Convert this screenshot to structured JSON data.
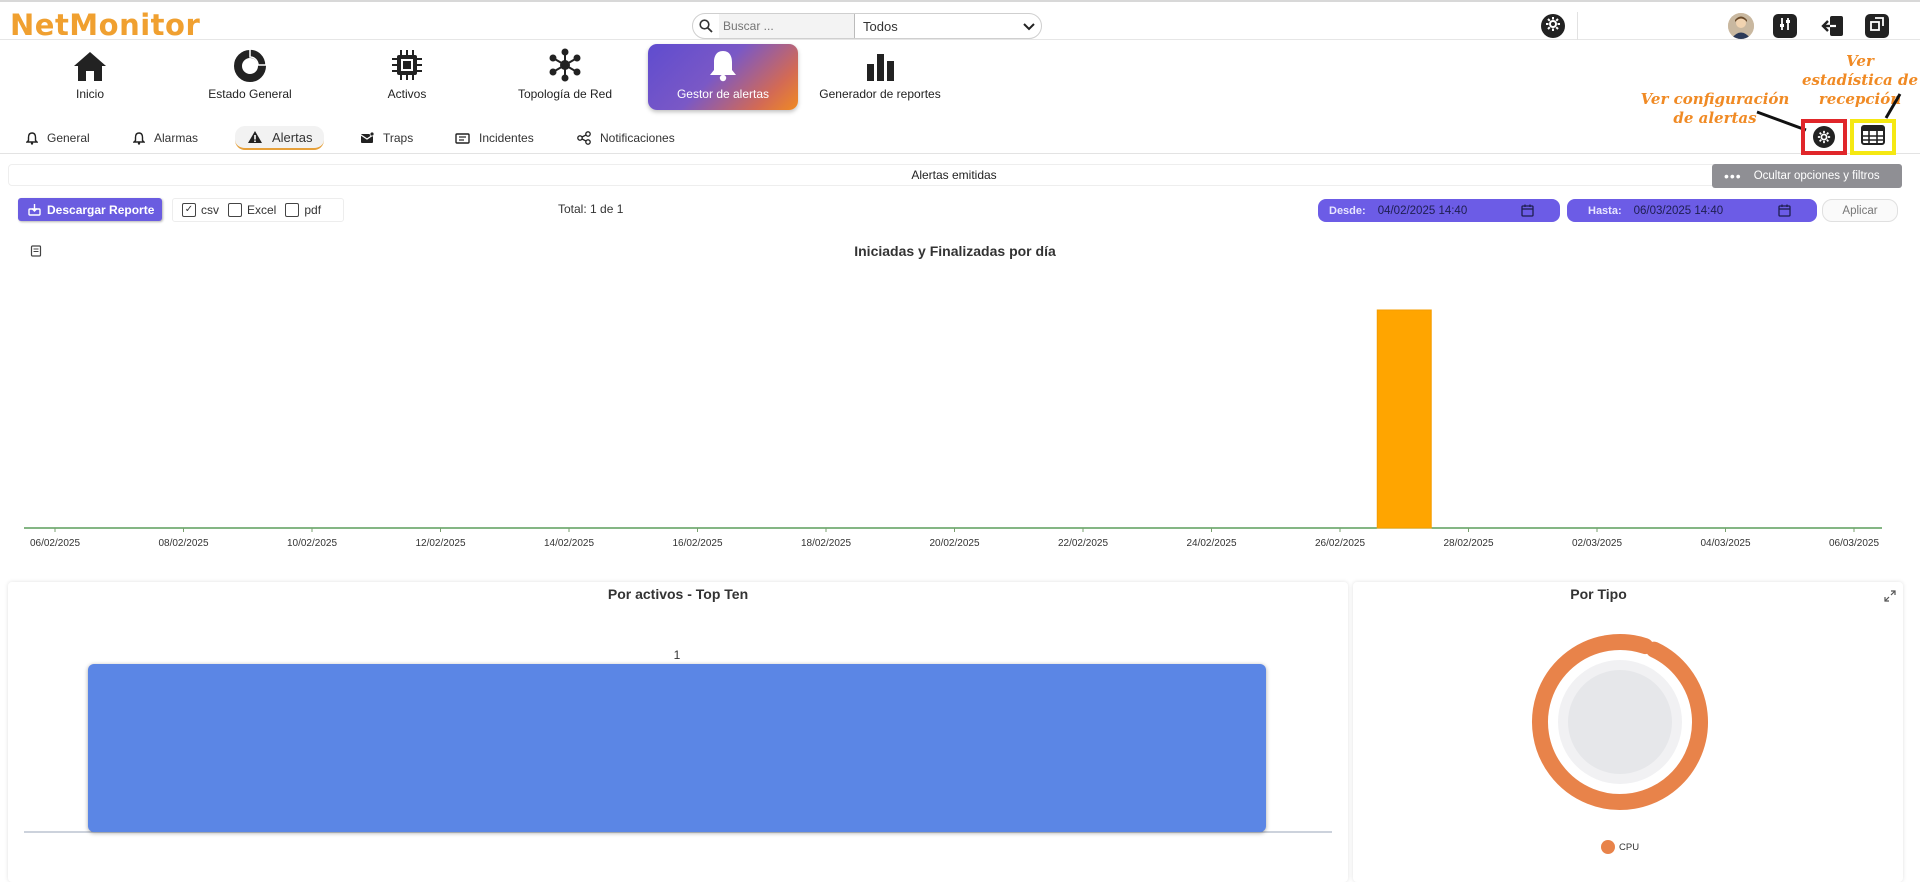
{
  "app": {
    "name": "NetMonitor"
  },
  "search": {
    "placeholder": "Buscar ...",
    "filter_value": "Todos"
  },
  "main_nav": [
    {
      "label": "Inicio",
      "icon": "home-icon"
    },
    {
      "label": "Estado General",
      "icon": "donut-chart-icon"
    },
    {
      "label": "Activos",
      "icon": "chip-icon"
    },
    {
      "label": "Topología de Red",
      "icon": "network-icon"
    },
    {
      "label": "Gestor de alertas",
      "icon": "bell-icon",
      "active": true
    },
    {
      "label": "Generador de reportes",
      "icon": "bar-chart-icon"
    }
  ],
  "sub_tabs": [
    {
      "label": "General",
      "icon": "bell-small-icon"
    },
    {
      "label": "Alarmas",
      "icon": "bell-small-icon"
    },
    {
      "label": "Alertas",
      "icon": "warning-icon",
      "active": true
    },
    {
      "label": "Traps",
      "icon": "envelope-icon"
    },
    {
      "label": "Incidentes",
      "icon": "ticket-icon"
    },
    {
      "label": "Notificaciones",
      "icon": "share-icon"
    }
  ],
  "section": {
    "title": "Alertas emitidas",
    "toggle_options_label": "Ocultar opciones y filtros"
  },
  "toolbar": {
    "download_label": "Descargar Reporte",
    "formats": [
      {
        "label": "csv",
        "checked": true
      },
      {
        "label": "Excel",
        "checked": false
      },
      {
        "label": "pdf",
        "checked": false
      }
    ],
    "total_text": "Total: 1 de 1",
    "desde_label": "Desde:",
    "desde_value": "04/02/2025 14:40",
    "hasta_label": "Hasta:",
    "hasta_value": "06/03/2025 14:40",
    "apply_label": "Aplicar"
  },
  "annotations": {
    "config": "Ver configuración de alertas",
    "stats": "Ver estadística de recepción"
  },
  "chart_data": [
    {
      "type": "bar",
      "title": "Iniciadas y Finalizadas por día",
      "x_tick_labels": [
        "06/02/2025",
        "08/02/2025",
        "10/02/2025",
        "12/02/2025",
        "14/02/2025",
        "16/02/2025",
        "18/02/2025",
        "20/02/2025",
        "22/02/2025",
        "24/02/2025",
        "26/02/2025",
        "28/02/2025",
        "02/03/2025",
        "04/03/2025",
        "06/03/2025"
      ],
      "bars": [
        {
          "x": "27/02/2025",
          "value": 1
        }
      ],
      "colors": {
        "bar": "#ffa500",
        "baseline": "#3a8a3a"
      }
    },
    {
      "type": "bar",
      "title": "Por activos - Top Ten",
      "categories": [
        ""
      ],
      "values": [
        1
      ],
      "data_labels": [
        "1"
      ],
      "colors": {
        "bar": "#5b86e5"
      }
    },
    {
      "type": "pie",
      "title": "Por Tipo",
      "slices": [
        {
          "label": "CPU",
          "value": 1
        }
      ],
      "colors": {
        "CPU": "#e8834a"
      }
    }
  ]
}
